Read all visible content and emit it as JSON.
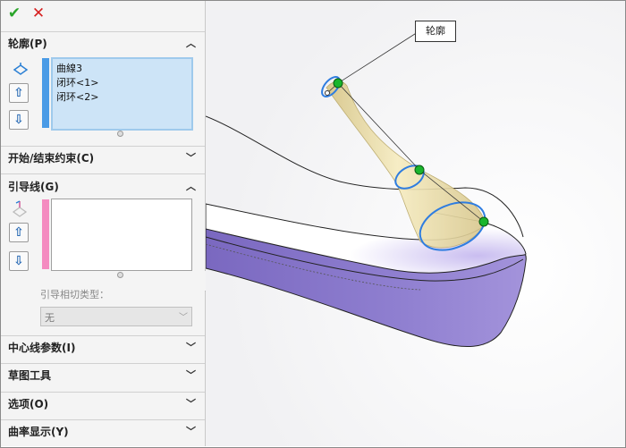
{
  "toolbar": {
    "ok_icon": "check-icon",
    "cancel_icon": "close-icon",
    "ok_color": "#2aa52a",
    "cancel_color": "#d62020"
  },
  "profile": {
    "title": "轮廓(P)",
    "items": [
      "曲線3",
      "闭环<1>",
      "闭环<2>"
    ],
    "accent": "#4a9be6"
  },
  "start_end": {
    "title": "开始/结束约束(C)"
  },
  "guides": {
    "title": "引导线(G)",
    "accent": "#f48bc0",
    "tangency_label": "引导相切类型：",
    "tangency_value": "无"
  },
  "centerline": {
    "title": "中心线参数(I)"
  },
  "sketch_tools": {
    "title": "草图工具"
  },
  "options": {
    "title": "选项(O)"
  },
  "curvature": {
    "title": "曲率显示(Y)"
  },
  "viewport": {
    "callout_label": "轮廓"
  }
}
